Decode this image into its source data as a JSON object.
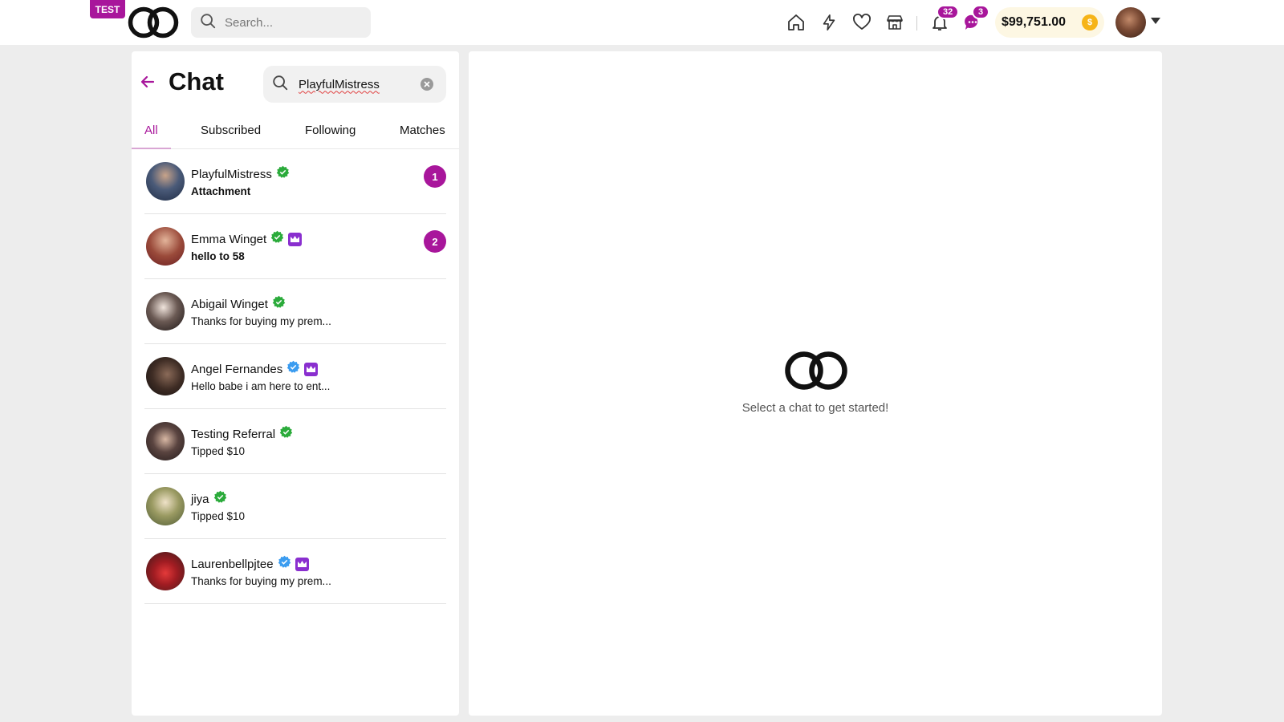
{
  "header": {
    "env_badge": "TEST",
    "search_placeholder": "Search...",
    "notifications_count": "32",
    "messages_count": "3",
    "balance": "$99,751.00",
    "brand_color": "#a8169b"
  },
  "chat": {
    "title": "Chat",
    "search_value": "PlayfulMistress",
    "tabs": [
      "All",
      "Subscribed",
      "Following",
      "Matches"
    ],
    "active_tab": "All",
    "conversations": [
      {
        "name": "PlayfulMistress",
        "last_message": "Attachment",
        "unread": "1",
        "verified": "green",
        "premium": false
      },
      {
        "name": "Emma Winget",
        "last_message": "hello to 58",
        "unread": "2",
        "verified": "green",
        "premium": true
      },
      {
        "name": "Abigail Winget",
        "last_message": "Thanks for buying my prem...",
        "unread": "",
        "verified": "green",
        "premium": false
      },
      {
        "name": "Angel Fernandes",
        "last_message": "Hello babe i am here to ent...",
        "unread": "",
        "verified": "blue",
        "premium": true
      },
      {
        "name": "Testing Referral",
        "last_message": "Tipped $10",
        "unread": "",
        "verified": "green",
        "premium": false
      },
      {
        "name": "jiya",
        "last_message": "Tipped $10",
        "unread": "",
        "verified": "green",
        "premium": false
      },
      {
        "name": "Laurenbellpjtee",
        "last_message": "Thanks for buying my prem...",
        "unread": "",
        "verified": "blue",
        "premium": true
      }
    ]
  },
  "empty_state": {
    "message": "Select a chat to get started!"
  }
}
